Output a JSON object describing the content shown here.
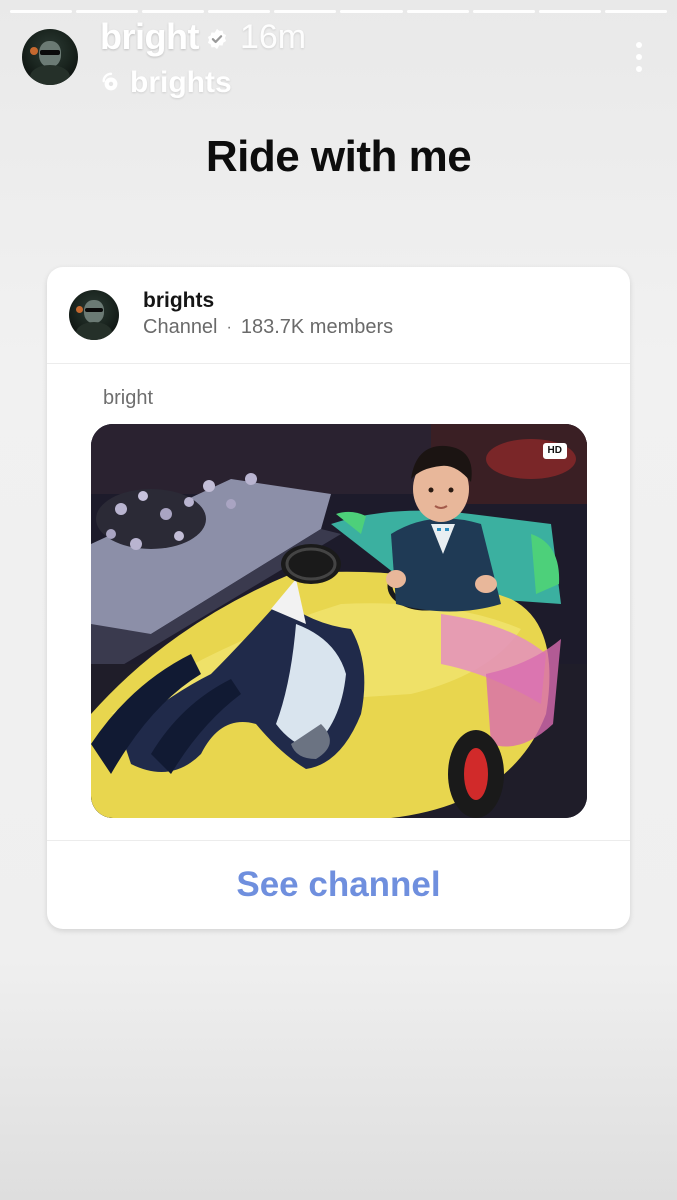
{
  "story": {
    "username": "bright",
    "time": "16m",
    "channel_name": "brights",
    "headline": "Ride with me",
    "progress_segments": 10
  },
  "card": {
    "channel_title": "brights",
    "channel_type": "Channel",
    "separator": "·",
    "members": "183.7K members",
    "post_author": "bright",
    "badge": "HD",
    "cta": "See channel"
  },
  "icons": {
    "verified": "verified-badge-icon",
    "channel": "broadcast-channel-icon",
    "more": "more-vertical-icon"
  },
  "colors": {
    "cta": "#6f8fde",
    "headline": "#0d0d0d"
  }
}
